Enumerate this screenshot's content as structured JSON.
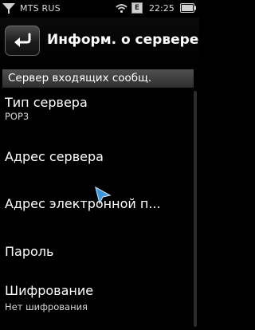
{
  "status_bar": {
    "carrier": "MTS RUS",
    "notification_badge": "E",
    "time": "22:25",
    "icons": [
      "signal-icon",
      "wifi-icon",
      "email-notification-icon",
      "battery-icon"
    ]
  },
  "header": {
    "title": "Информ. о сервере",
    "back_icon": "back-arrow-icon"
  },
  "section": {
    "title": "Сервер входящих сообщ."
  },
  "items": [
    {
      "label": "Тип сервера",
      "value": "POP3"
    },
    {
      "label": "Адрес сервера",
      "value": ""
    },
    {
      "label": "Адрес электронной п...",
      "value": ""
    },
    {
      "label": "Пароль",
      "value": ""
    },
    {
      "label": "Шифрование",
      "value": "Нет шифрования"
    }
  ],
  "colors": {
    "background": "#000000",
    "section_header": "#404040",
    "text": "#ffffff",
    "cursor_accent": "#3fa9f5"
  }
}
